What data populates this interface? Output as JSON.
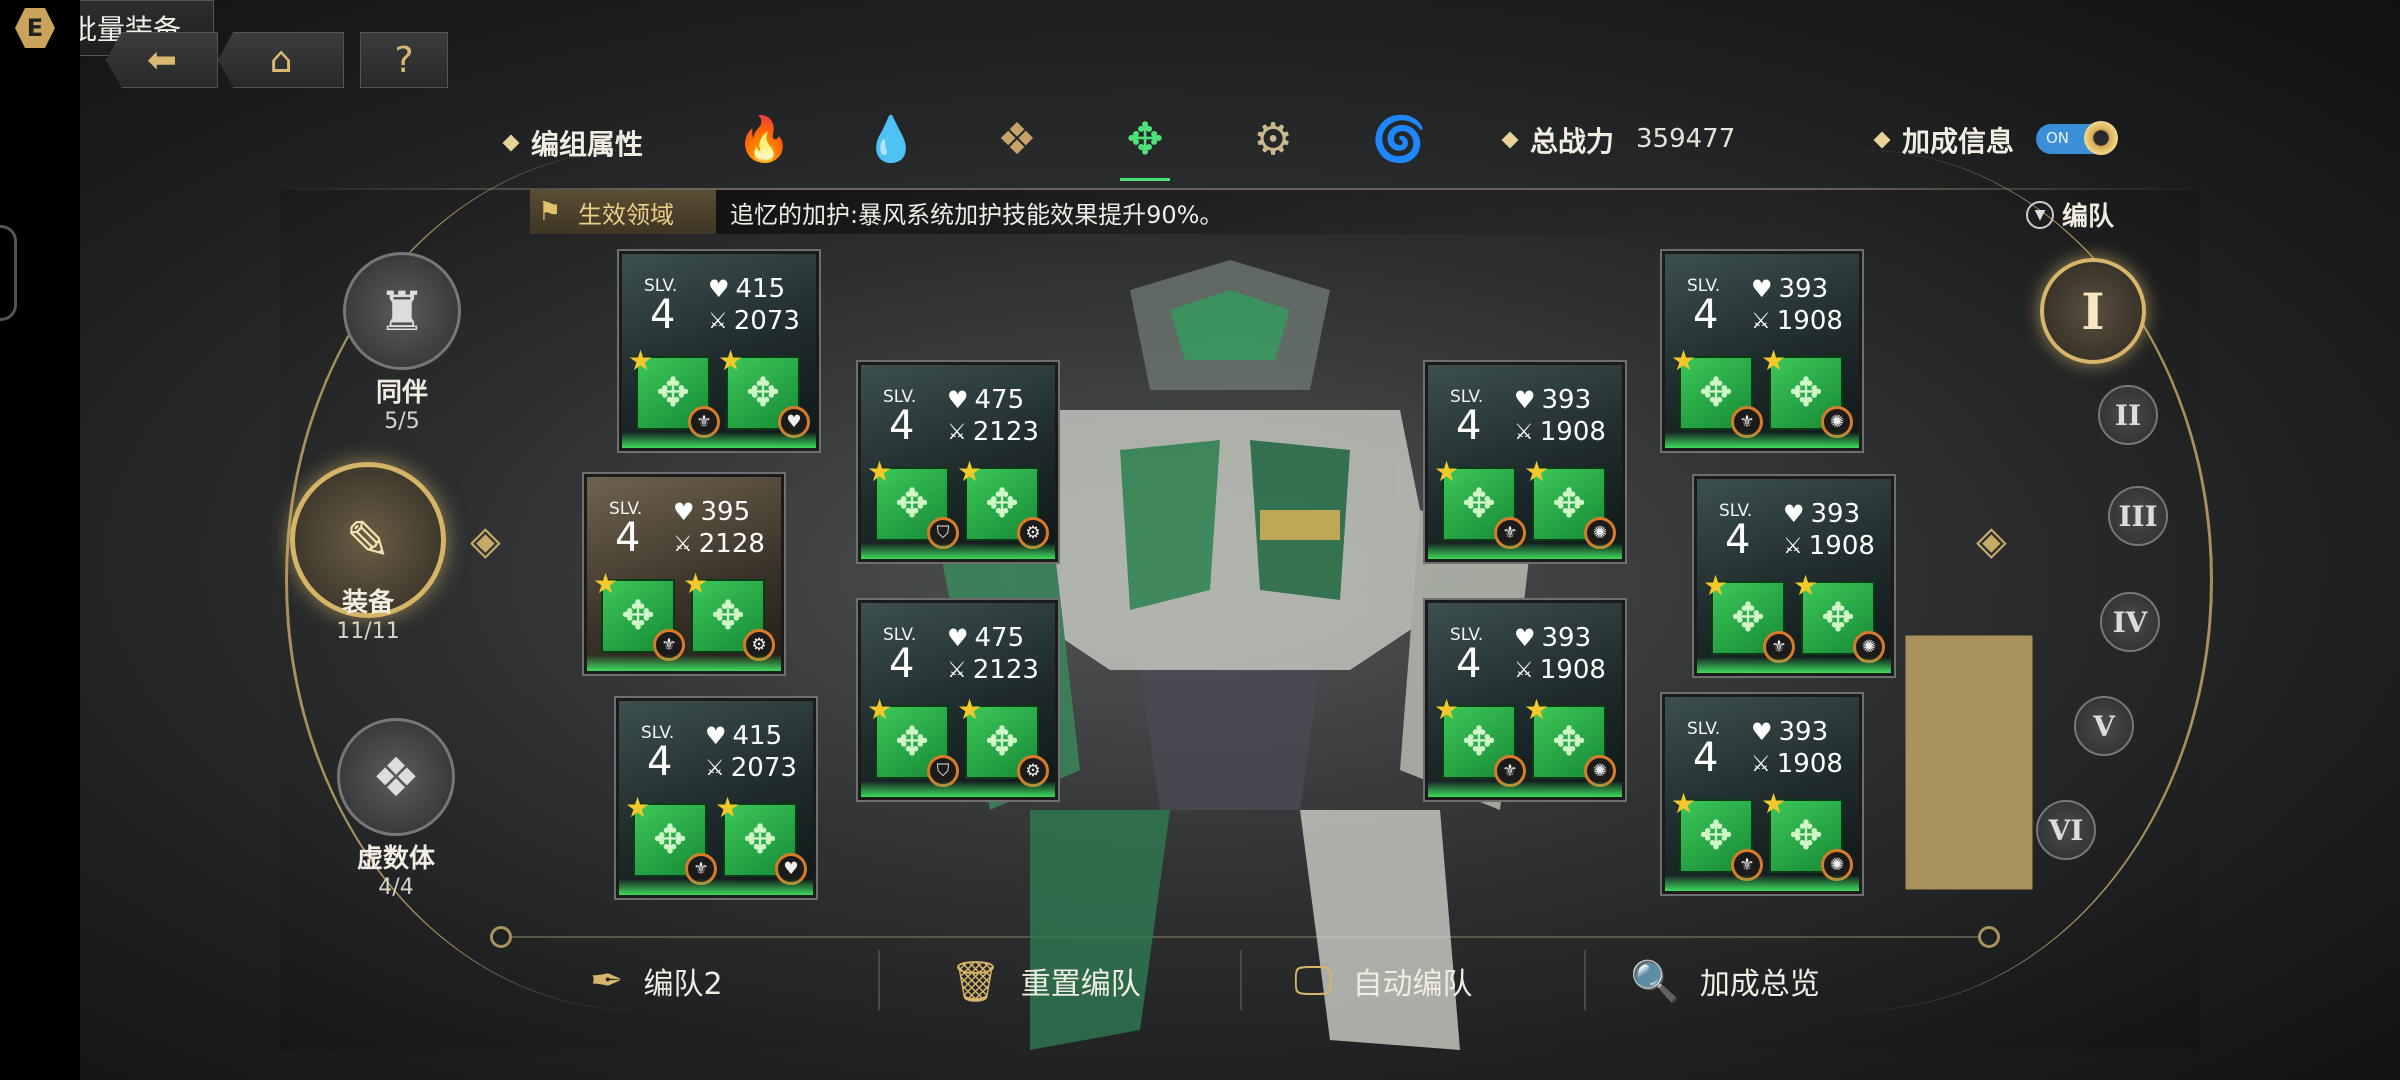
{
  "nav": {
    "back_icon": "back-arrow-icon",
    "home_icon": "home-icon",
    "help_label": "?",
    "batch_equip": {
      "badge": "E",
      "label": "批量装备"
    }
  },
  "attributes": {
    "label": "编组属性",
    "elements": [
      {
        "name": "fire",
        "icon": "fire-icon"
      },
      {
        "name": "water",
        "icon": "water-icon"
      },
      {
        "name": "earth",
        "icon": "earth-icon"
      },
      {
        "name": "wind",
        "icon": "wind-icon",
        "selected": true
      },
      {
        "name": "light",
        "icon": "gear-icon"
      },
      {
        "name": "dark",
        "icon": "vortex-icon"
      }
    ]
  },
  "power": {
    "label": "总战力",
    "value": "359477"
  },
  "bonus": {
    "label": "加成信息",
    "toggle": "ON",
    "enabled": true
  },
  "domain": {
    "tag": "生效领域",
    "text": "追忆的加护:暴风系统加护技能效果提升90%。"
  },
  "team": {
    "label": "编队",
    "numerals": [
      "I",
      "II",
      "III",
      "IV",
      "V",
      "VI"
    ],
    "active_index": 0
  },
  "left_nav": [
    {
      "name": "同伴",
      "count": "5/5"
    },
    {
      "name": "装备",
      "count": "11/11",
      "active": true
    },
    {
      "name": "虚数体",
      "count": "4/4"
    }
  ],
  "cards": [
    {
      "slv": "SLV.",
      "level": "4",
      "hp": "415",
      "atk": "2073",
      "badges": [
        "fleur-icon",
        "heart-gear-icon"
      ]
    },
    {
      "slv": "SLV.",
      "level": "4",
      "hp": "395",
      "atk": "2128",
      "badges": [
        "fleur-icon",
        "gear-icon"
      ]
    },
    {
      "slv": "SLV.",
      "level": "4",
      "hp": "415",
      "atk": "2073",
      "badges": [
        "fleur-icon",
        "heart-gear-icon"
      ]
    },
    {
      "slv": "SLV.",
      "level": "4",
      "hp": "475",
      "atk": "2123",
      "badges": [
        "shield-icon",
        "gear-icon"
      ]
    },
    {
      "slv": "SLV.",
      "level": "4",
      "hp": "475",
      "atk": "2123",
      "badges": [
        "shield-icon",
        "gear-icon"
      ]
    },
    {
      "slv": "SLV.",
      "level": "4",
      "hp": "393",
      "atk": "1908",
      "badges": [
        "fleur-icon",
        "spiral-icon"
      ]
    },
    {
      "slv": "SLV.",
      "level": "4",
      "hp": "393",
      "atk": "1908",
      "badges": [
        "fleur-icon",
        "spiral-icon"
      ]
    },
    {
      "slv": "SLV.",
      "level": "4",
      "hp": "393",
      "atk": "1908",
      "badges": [
        "fleur-icon",
        "spiral-icon"
      ]
    },
    {
      "slv": "SLV.",
      "level": "4",
      "hp": "393",
      "atk": "1908",
      "badges": [
        "fleur-icon",
        "spiral-icon"
      ]
    },
    {
      "slv": "SLV.",
      "level": "4",
      "hp": "393",
      "atk": "1908",
      "badges": [
        "fleur-icon",
        "spiral-icon"
      ]
    }
  ],
  "bottom": {
    "team_name": "编队2",
    "reset": "重置编队",
    "auto": "自动编队",
    "overview": "加成总览"
  },
  "colors": {
    "accent_gold": "#d7b56b",
    "chip_green": "#3cc759",
    "toggle_blue": "#3a8fd6"
  }
}
